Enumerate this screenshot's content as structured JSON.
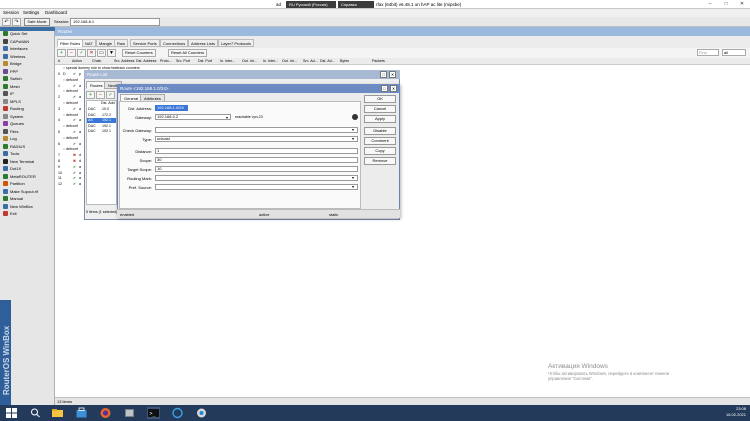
{
  "titlebar": {
    "keyboard": "RU Русский (Россия)",
    "input_mode": "Справка",
    "title": "rfax (64bit) v6.48.1 on hAP ac lite (mipsbe)",
    "title_prefix": "ad"
  },
  "menu": [
    "Session",
    "Settings",
    "Dashboard"
  ],
  "toolbar": {
    "safe_mode": "Safe Mode",
    "session_label": "Session:",
    "session_value": "192.168.8.1"
  },
  "sidebar": {
    "items": [
      "Quick Set",
      "CAPsMAN",
      "Interfaces",
      "Wireless",
      "Bridge",
      "PPP",
      "Switch",
      "Mesh",
      "IP",
      "MPLS",
      "Routing",
      "System",
      "Queues",
      "Files",
      "Log",
      "RADIUS",
      "Tools",
      "New Terminal",
      "Dot1X",
      "MetaROUTER",
      "Partition",
      "Make Supout.rif",
      "Manual",
      "New WinBox",
      "Exit"
    ],
    "brand": "RouterOS WinBox"
  },
  "route_window": {
    "title": "Routes",
    "tabs": [
      "Filter Rules",
      "NAT",
      "Mangle",
      "Raw",
      "Service Ports",
      "Connections",
      "Address Lists",
      "Layer7 Protocols"
    ],
    "reset_counters": "Reset Counters",
    "reset_all_counters": "Reset All Counters",
    "find_placeholder": "Find",
    "all": "all",
    "columns": [
      "#",
      "Action",
      "Chain",
      "Src. Address",
      "Dst. Address",
      "Proto...",
      "Src. Port",
      "Dst. Port",
      "In. Inter...",
      "Out. Int...",
      "In. Inter...",
      "Out. Int...",
      "Src. Ad...",
      "Dst. Ad...",
      "Bytes",
      "Packets"
    ],
    "comment_row": ":: special dummy rule to show fasttrack counters",
    "rows": [
      {
        "num": "0",
        "flag": "D",
        "text": "p"
      },
      {
        "num": "",
        "flag": "",
        "text": ":: defconf"
      },
      {
        "num": "1",
        "flag": "",
        "text": "a"
      },
      {
        "num": "",
        "flag": "",
        "text": ":: defconf"
      },
      {
        "num": "2",
        "flag": "",
        "text": "a"
      },
      {
        "num": "",
        "flag": "",
        "text": ":: defconf"
      },
      {
        "num": "3",
        "flag": "",
        "text": "a"
      },
      {
        "num": "",
        "flag": "",
        "text": ":: defconf"
      },
      {
        "num": "4",
        "flag": "",
        "text": "a"
      },
      {
        "num": "",
        "flag": "",
        "text": ":: defconf"
      },
      {
        "num": "5",
        "flag": "",
        "text": "a"
      },
      {
        "num": "",
        "flag": "",
        "text": ":: defconf"
      },
      {
        "num": "6",
        "flag": "",
        "text": "a"
      },
      {
        "num": "",
        "flag": "",
        "text": ":: defconf"
      },
      {
        "num": "7",
        "flag": "",
        "text": "d"
      },
      {
        "num": "8",
        "flag": "",
        "text": "d"
      },
      {
        "num": "9",
        "flag": "",
        "text": "a"
      },
      {
        "num": "10",
        "flag": "",
        "text": "a"
      },
      {
        "num": "11",
        "flag": "",
        "text": "a"
      },
      {
        "num": "12",
        "flag": "",
        "text": "a"
      }
    ],
    "status": "13 items"
  },
  "route_list": {
    "title": "Route List",
    "tabs": [
      "Routes",
      "Nexth"
    ],
    "col_header": "Dst. Add",
    "rows": [
      {
        "flag": "DAC",
        "dst": "10.0"
      },
      {
        "flag": "DAC",
        "dst": "172.2"
      },
      {
        "flag": "AS",
        "dst": "192.1"
      },
      {
        "flag": "DAC",
        "dst": "192.1"
      },
      {
        "flag": "DAC",
        "dst": "192.1"
      }
    ],
    "status": "5 items (1 selected)"
  },
  "dialog": {
    "title": "Route <192.168.1.0/24>",
    "tabs": [
      "General",
      "Attributes"
    ],
    "fields": {
      "dst_address_label": "Dst. Address:",
      "dst_address": "192.168.1.0/24",
      "gateway_label": "Gateway:",
      "gateway": "192.168.0.2",
      "gateway_status": "reachable vpn-23",
      "check_gateway_label": "Check Gateway:",
      "check_gateway": "",
      "type_label": "Type:",
      "type": "unicast",
      "distance_label": "Distance:",
      "distance": "1",
      "scope_label": "Scope:",
      "scope": "30",
      "target_scope_label": "Target Scope:",
      "target_scope": "10",
      "routing_mark_label": "Routing Mark:",
      "routing_mark": "",
      "pref_source_label": "Pref. Source:",
      "pref_source": ""
    },
    "buttons": [
      "OK",
      "Cancel",
      "Apply",
      "Disable",
      "Comment",
      "Copy",
      "Remove"
    ],
    "status": {
      "enabled": "enabled",
      "active": "active",
      "static": "static"
    }
  },
  "activation": {
    "title": "Активация Windows",
    "line1": "Чтобы активировать Windows, перейдите в компонент панели",
    "line2": "управления \"Система\"."
  },
  "clock": {
    "time": "23:08",
    "date": "16.02.2021"
  }
}
